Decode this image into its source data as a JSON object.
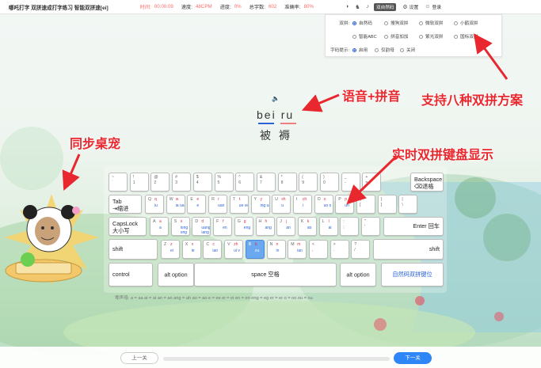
{
  "header": {
    "title": "哪吒打字 双拼速成打字练习 智能双拼速[ei]",
    "stats": [
      {
        "label": "时间:",
        "value": "00:00:09"
      },
      {
        "label": "速度:",
        "value": "48CPM"
      },
      {
        "label": "进度:",
        "value": "0%"
      },
      {
        "label": "总字数:",
        "value": "602"
      },
      {
        "label": "准确率:",
        "value": "80%"
      }
    ],
    "mode_label": "双自然码",
    "settings_label": "设置",
    "login_label": "登录"
  },
  "settings": {
    "scheme_label": "双拼:",
    "schemes": [
      "自然码",
      "搜狗双拼",
      "微软双拼",
      "小鹤双拼",
      "智能ABC",
      "拼音加加",
      "紫光双拼",
      "国标双拼"
    ],
    "selected_scheme": "自然码",
    "hint_label": "字码提示:",
    "hints": [
      "启用",
      "仅韵母",
      "关闭"
    ],
    "selected_hint": "启用"
  },
  "annotations": {
    "voice": "语音+拼音",
    "schemes": "支持八种双拼方案",
    "keyboard": "实时双拼键盘显示",
    "pet": "同步桌宠"
  },
  "practice": {
    "syllables": [
      "bei",
      "ru"
    ],
    "hanzi": [
      "被",
      "褥"
    ],
    "colors": {
      "done": "#2b63d9",
      "pending": "#f08080"
    }
  },
  "keyboard": {
    "row1": [
      {
        "top": "~",
        "bot": "`"
      },
      {
        "top": "!",
        "bot": "1"
      },
      {
        "top": "@",
        "bot": "2"
      },
      {
        "top": "#",
        "bot": "3"
      },
      {
        "top": "$",
        "bot": "4"
      },
      {
        "top": "%",
        "bot": "5"
      },
      {
        "top": "^",
        "bot": "6"
      },
      {
        "top": "&",
        "bot": "7"
      },
      {
        "top": "*",
        "bot": "8"
      },
      {
        "top": "(",
        "bot": "9"
      },
      {
        "top": ")",
        "bot": "0"
      },
      {
        "top": "_",
        "bot": "-"
      },
      {
        "top": "+",
        "bot": "="
      }
    ],
    "backspace": [
      "Backspace",
      "⌫退格"
    ],
    "tab": [
      "Tab",
      "⇥缩进"
    ],
    "row2": [
      {
        "top": "Q",
        "sm1": "q",
        "sm2": "iu"
      },
      {
        "top": "W",
        "sm1": "w",
        "sm2": "ia ua"
      },
      {
        "top": "E",
        "sm1": "e",
        "sm2": "e"
      },
      {
        "top": "R",
        "sm1": "r",
        "sm2": "uan"
      },
      {
        "top": "T",
        "sm1": "t",
        "sm2": "ue ve"
      },
      {
        "top": "Y",
        "sm1": "y",
        "sm2": "ing uai"
      },
      {
        "top": "U",
        "sm1": "sh",
        "sm2": "u"
      },
      {
        "top": "I",
        "sm1": "ch",
        "sm2": "i"
      },
      {
        "top": "O",
        "sm1": "o",
        "sm2": "uo o"
      },
      {
        "top": "P",
        "sm1": "p",
        "sm2": "un"
      },
      {
        "top": "{",
        "bot": "["
      },
      {
        "top": "}",
        "bot": "]"
      },
      {
        "top": "|",
        "bot": "\\"
      }
    ],
    "capslock": [
      "CapsLock",
      "大小写"
    ],
    "row3": [
      {
        "top": "A",
        "sm1": "a",
        "sm2": "a"
      },
      {
        "top": "S",
        "sm1": "s",
        "sm2": "iong ong"
      },
      {
        "top": "D",
        "sm1": "d",
        "sm2": "uang iang"
      },
      {
        "top": "F",
        "sm1": "f",
        "sm2": "en"
      },
      {
        "top": "G",
        "sm1": "g",
        "sm2": "eng"
      },
      {
        "top": "H",
        "sm1": "h",
        "sm2": "ang"
      },
      {
        "top": "J",
        "sm1": "j",
        "sm2": "an"
      },
      {
        "top": "K",
        "sm1": "k",
        "sm2": "ao"
      },
      {
        "top": "L",
        "sm1": "l",
        "sm2": "ai"
      },
      {
        "top": ":",
        "bot": ";"
      },
      {
        "top": "\"",
        "bot": "'"
      }
    ],
    "enter": "Enter 回车",
    "shift": "shift",
    "row4": [
      {
        "top": "Z",
        "sm1": "z",
        "sm2": "ei"
      },
      {
        "top": "X",
        "sm1": "x",
        "sm2": "ie"
      },
      {
        "top": "C",
        "sm1": "c",
        "sm2": "iao"
      },
      {
        "top": "V",
        "sm1": "zh",
        "sm2": "ui v"
      },
      {
        "top": "B",
        "sm1": "b",
        "sm2": "ou"
      },
      {
        "top": "N",
        "sm1": "n",
        "sm2": "in"
      },
      {
        "top": "M",
        "sm1": "m",
        "sm2": "ian"
      },
      {
        "top": "<",
        "bot": ","
      },
      {
        "top": ">",
        "bot": "."
      },
      {
        "top": "?",
        "bot": "/"
      }
    ],
    "highlighted": "B",
    "control": "control",
    "alt": "alt option",
    "space": "space 空格",
    "scheme_button": "自然码双拼键位"
  },
  "legend": "零声母:  a = aa   ai = ai   an = an   ang = ah   ao = ao   e = ee   ei = ei   en = en   eng = eg   er = er   o = oo   ou = ou",
  "footer": {
    "prev": "上一关",
    "next": "下一关",
    "progress": 0
  }
}
